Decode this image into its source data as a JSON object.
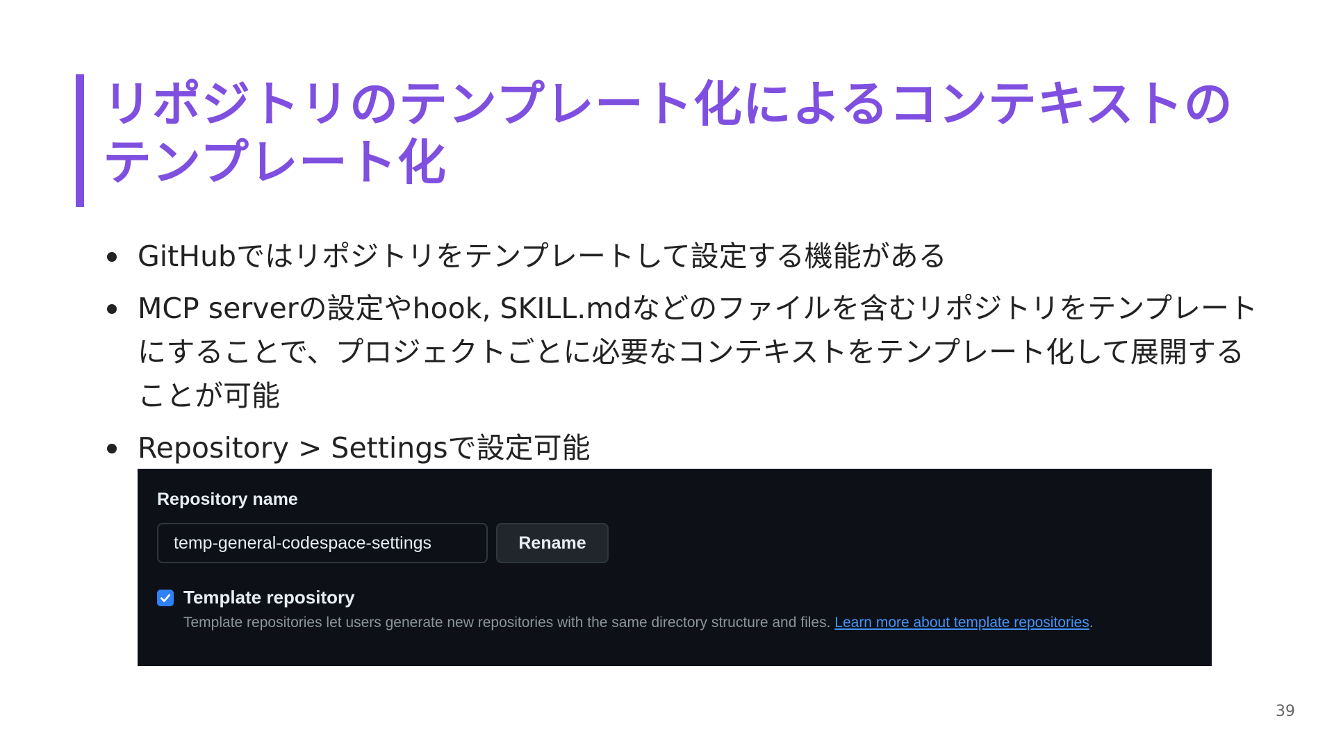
{
  "slide": {
    "title_line1": "リポジトリのテンプレート化によるコンテキストの",
    "title_line2": "テンプレート化",
    "bullets": [
      {
        "text": "GitHubではリポジトリをテンプレートして設定する機能がある"
      },
      {
        "text": "MCP serverの設定やhook, SKILL.mdなどのファイルを含むリポジトリをテンプレートにすることで、プロジェクトごとに必要なコンテキストをテンプレート化して展開することが可能"
      },
      {
        "text": "Repository > Settingsで設定可能"
      }
    ],
    "page_number": "39"
  },
  "settings_panel": {
    "repository_name_label": "Repository name",
    "repository_name_value": "temp-general-codespace-settings",
    "rename_button": "Rename",
    "template_checked": true,
    "template_label": "Template repository",
    "template_description": "Template repositories let users generate new repositories with the same directory structure and files.",
    "learn_more_link": "Learn more about template repositories",
    "link_suffix": ".",
    "colors": {
      "panel_bg": "#0d1117",
      "accent_blue": "#2f81f7",
      "link_blue": "#4493f8"
    }
  },
  "colors": {
    "title": "#7f4fe0",
    "body_text": "#222222"
  }
}
